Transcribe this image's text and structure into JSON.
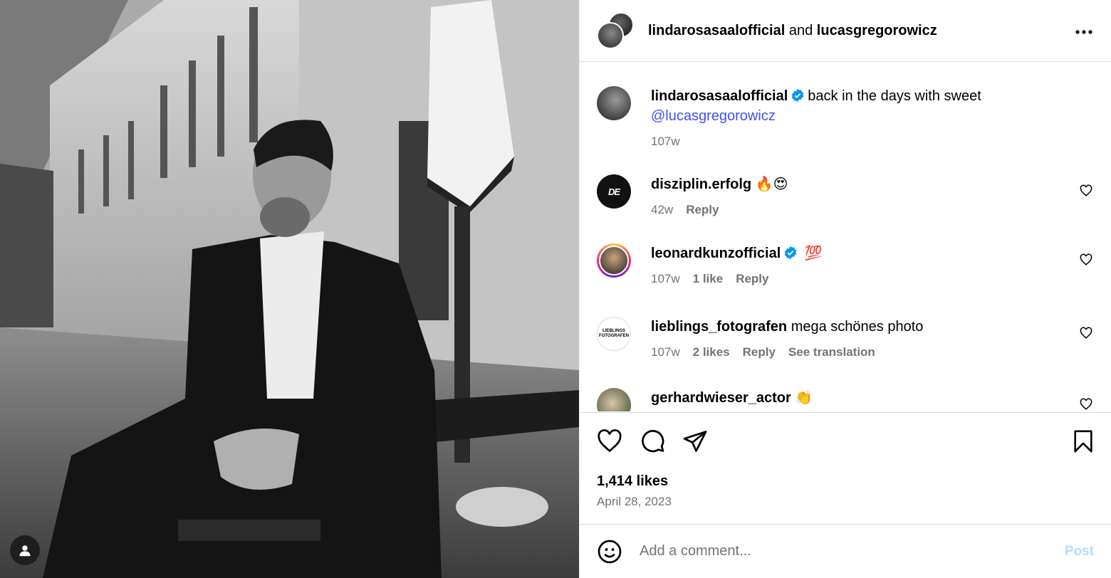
{
  "header": {
    "user1": "lindarosasaalofficial",
    "joiner": "and",
    "user2": "lucasgregorowicz",
    "more_icon": "more-horizontal-icon"
  },
  "caption": {
    "username": "lindarosasaalofficial",
    "text": "back in the days with sweet",
    "mention": "@lucasgregorowicz",
    "time": "107w"
  },
  "comments": [
    {
      "username": "disziplin.erfolg",
      "text": "🔥😍",
      "time": "42w",
      "likes": "",
      "reply": "Reply",
      "translate": "",
      "verified": false
    },
    {
      "username": "leonardkunzofficial",
      "text": "💯",
      "time": "107w",
      "likes": "1 like",
      "reply": "Reply",
      "translate": "",
      "verified": true
    },
    {
      "username": "lieblings_fotografen",
      "text": "mega schönes photo",
      "time": "107w",
      "likes": "2 likes",
      "reply": "Reply",
      "translate": "See translation",
      "verified": false
    },
    {
      "username": "gerhardwieser_actor",
      "text": "👏",
      "time": "",
      "likes": "",
      "reply": "",
      "translate": "",
      "verified": false
    }
  ],
  "avatars": {
    "disziplin_logo": "DE",
    "lieblings_logo_line1": "LIEBLINGS",
    "lieblings_logo_line2": "FOTOGRAFEN"
  },
  "post": {
    "likes": "1,414 likes",
    "date": "April 28, 2023"
  },
  "composer": {
    "placeholder": "Add a comment...",
    "post_label": "Post"
  },
  "colors": {
    "mention": "#4150f7",
    "verified": "#0095f6",
    "post_disabled": "#b3dbff",
    "secondary_text": "#737373"
  }
}
